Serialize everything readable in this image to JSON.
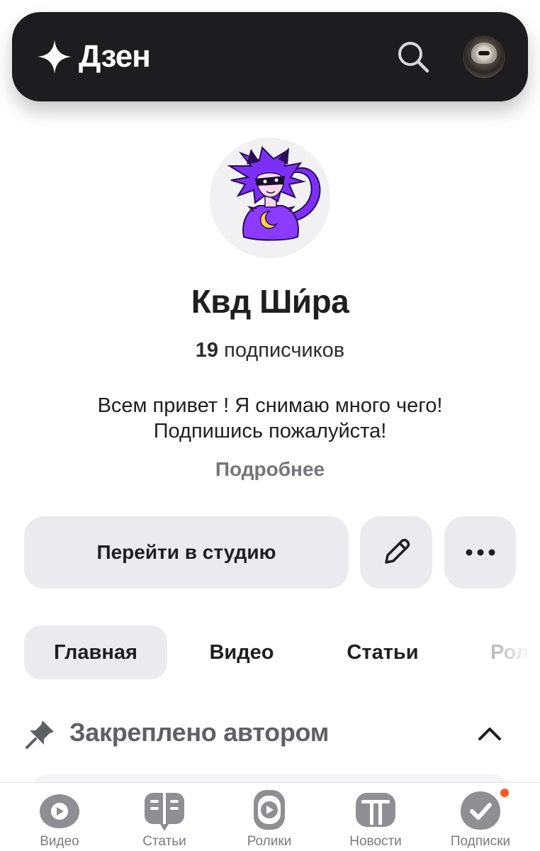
{
  "header": {
    "logo_text": "Дзен",
    "logo_icon": "sparkle-star-icon",
    "search_icon": "search-icon",
    "avatar_icon": "user-avatar"
  },
  "channel": {
    "avatar_icon": "purple-cat-character-avatar",
    "name": "Квд Ши́ра",
    "subscribers_count": "19",
    "subscribers_label": "подписчиков",
    "description_line1": "Всем привет ! Я снимаю много чего!",
    "description_line2": "Подпишись пожалуйста!",
    "more_link": "Подробнее"
  },
  "actions": {
    "studio_button": "Перейти в студию",
    "edit_icon": "pencil-icon",
    "more_icon": "more-dots-icon"
  },
  "tabs": [
    {
      "label": "Главная",
      "active": true
    },
    {
      "label": "Видео",
      "active": false
    },
    {
      "label": "Статьи",
      "active": false
    },
    {
      "label": "Ролики",
      "active": false
    }
  ],
  "pinned": {
    "icon": "pin-icon",
    "title": "Закреплено автором",
    "collapse_icon": "chevron-up-icon"
  },
  "bottom_nav": [
    {
      "label": "Видео",
      "icon": "video-play-icon"
    },
    {
      "label": "Статьи",
      "icon": "articles-book-icon"
    },
    {
      "label": "Ролики",
      "icon": "shorts-icon"
    },
    {
      "label": "Новости",
      "icon": "news-icon"
    },
    {
      "label": "Подписки",
      "icon": "subscriptions-check-icon",
      "badge": true
    }
  ],
  "colors": {
    "header_bg": "#1d1d1f",
    "button_bg": "#ebebef",
    "nav_icon": "#8e8e93",
    "badge": "#ff5722",
    "avatar_purple": "#7b2ff7"
  }
}
